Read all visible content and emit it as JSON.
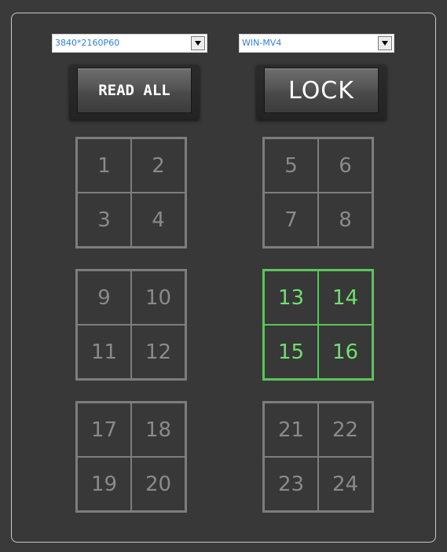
{
  "controls": {
    "resolution": {
      "value": "3840*2160P60"
    },
    "mode": {
      "value": "WIN-MV4"
    },
    "read_all_label": "READ ALL",
    "lock_label": "LOCK"
  },
  "colors": {
    "background": "#3a3a3a",
    "cell_inactive": "#7d7d7d",
    "cell_active": "#5cc45c",
    "dropdown_text": "#2f7fe0"
  },
  "groups": [
    {
      "cells": [
        "1",
        "2",
        "3",
        "4"
      ],
      "active": false
    },
    {
      "cells": [
        "5",
        "6",
        "7",
        "8"
      ],
      "active": false
    },
    {
      "cells": [
        "9",
        "10",
        "11",
        "12"
      ],
      "active": false
    },
    {
      "cells": [
        "13",
        "14",
        "15",
        "16"
      ],
      "active": true
    },
    {
      "cells": [
        "17",
        "18",
        "19",
        "20"
      ],
      "active": false
    },
    {
      "cells": [
        "21",
        "22",
        "23",
        "24"
      ],
      "active": false
    }
  ]
}
